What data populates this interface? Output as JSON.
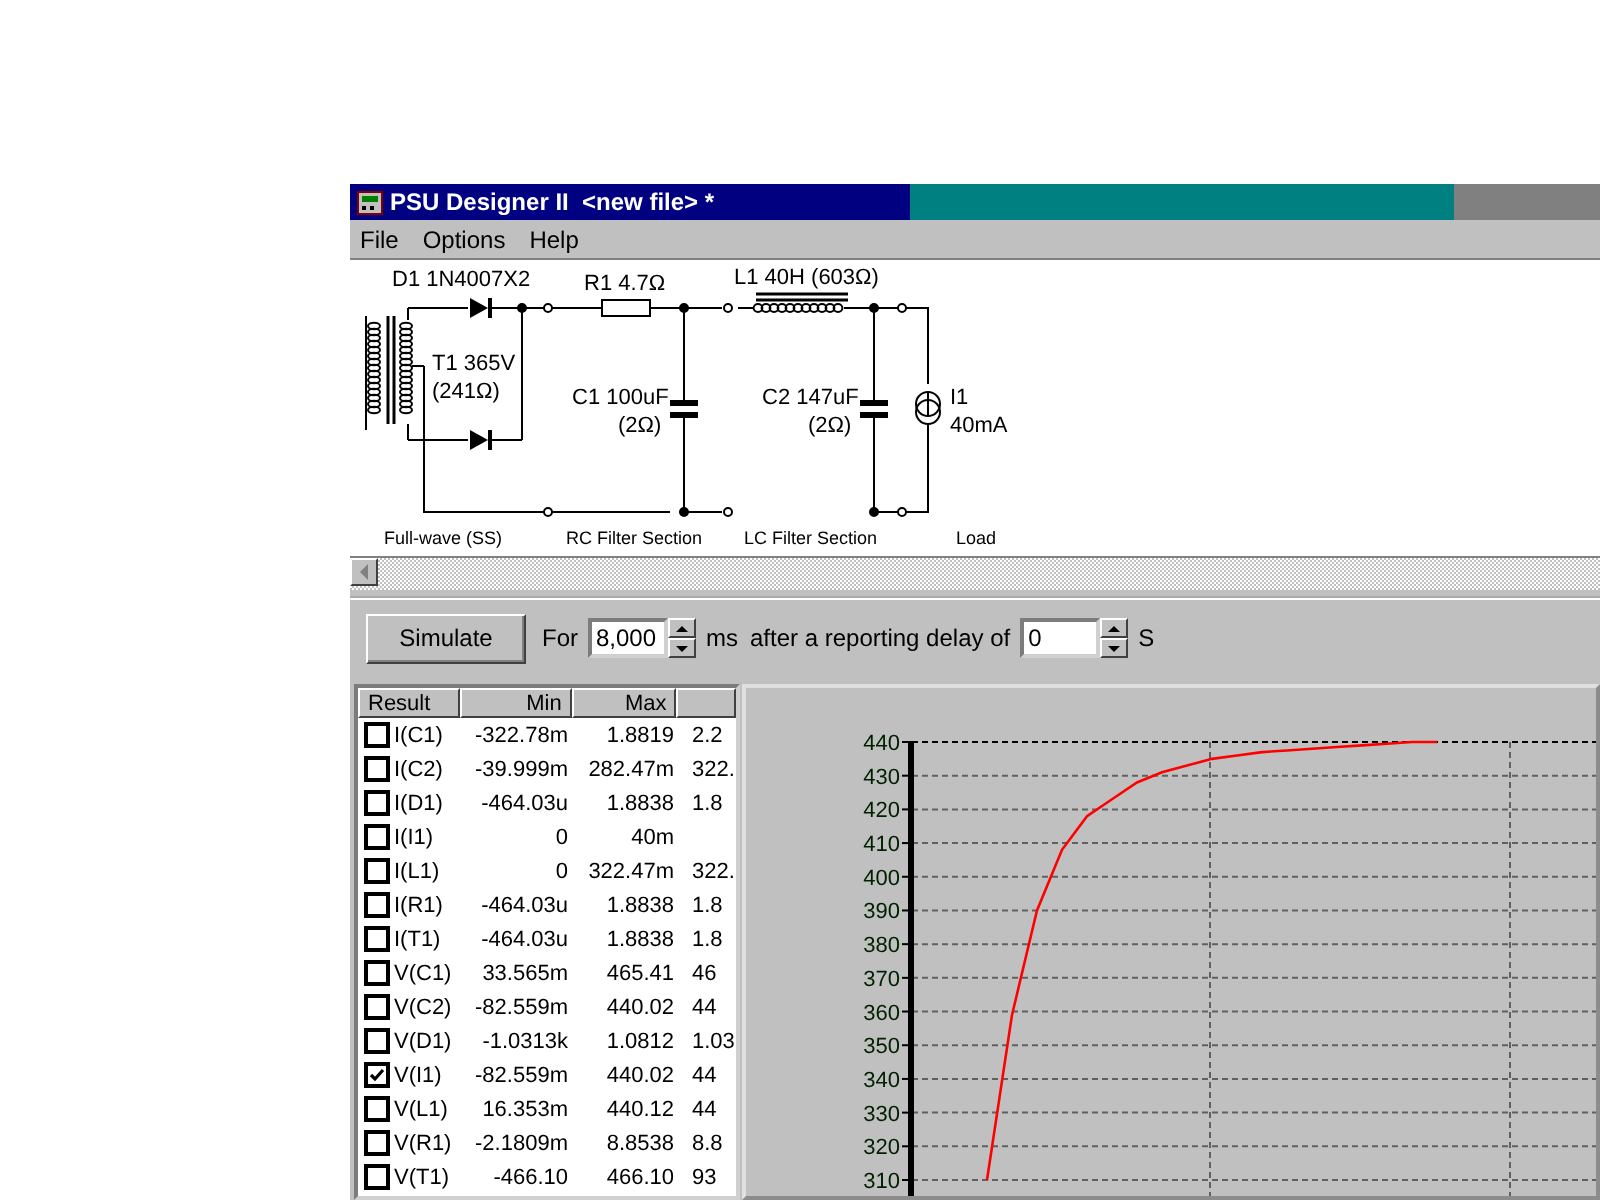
{
  "window": {
    "title": "PSU Designer II  <new file> *"
  },
  "menu": [
    "File",
    "Options",
    "Help"
  ],
  "schematic": {
    "components": [
      {
        "kind": "diode",
        "lines": [
          "D1 1N4007X2"
        ]
      },
      {
        "kind": "transformer",
        "lines": [
          "T1 365V",
          "(241Ω)"
        ]
      },
      {
        "kind": "resistor",
        "lines": [
          "R1 4.7Ω"
        ]
      },
      {
        "kind": "capacitor1",
        "lines": [
          "C1 100uF",
          "(2Ω)"
        ]
      },
      {
        "kind": "inductor",
        "lines": [
          "L1 40H (603Ω)"
        ]
      },
      {
        "kind": "capacitor2",
        "lines": [
          "C2 147uF",
          "(2Ω)"
        ]
      },
      {
        "kind": "load",
        "lines": [
          "I1",
          "40mA"
        ]
      }
    ],
    "sections": [
      "Full-wave (SS)",
      "RC Filter Section",
      "LC Filter Section",
      "Load"
    ]
  },
  "controls": {
    "simulate": "Simulate",
    "for_label": "For",
    "duration": "8,000",
    "duration_unit": "ms",
    "delay_label": "after a reporting delay of",
    "delay": "0",
    "delay_unit": "S"
  },
  "results": {
    "columns": [
      "Result",
      "Min",
      "Max"
    ],
    "rows": [
      {
        "name": "I(C1)",
        "min": "-322.78m",
        "max": "1.8819",
        "column_4": "2.2",
        "checked": false
      },
      {
        "name": "I(C2)",
        "min": "-39.999m",
        "max": "282.47m",
        "column_4": "322.",
        "checked": false
      },
      {
        "name": "I(D1)",
        "min": "-464.03u",
        "max": "1.8838",
        "column_4": "1.8",
        "checked": false
      },
      {
        "name": "I(I1)",
        "min": "0",
        "max": "40m",
        "checked": false
      },
      {
        "name": "I(L1)",
        "min": "0",
        "max": "322.47m",
        "column_4": "322.",
        "checked": false
      },
      {
        "name": "I(R1)",
        "min": "-464.03u",
        "max": "1.8838",
        "column_4": "1.8",
        "checked": false
      },
      {
        "name": "I(T1)",
        "min": "-464.03u",
        "max": "1.8838",
        "column_4": "1.8",
        "checked": false
      },
      {
        "name": "V(C1)",
        "min": "33.565m",
        "max": "465.41",
        "column_4": "46",
        "checked": false
      },
      {
        "name": "V(C2)",
        "min": "-82.559m",
        "max": "440.02",
        "column_4": "44",
        "checked": false
      },
      {
        "name": "V(D1)",
        "min": "-1.0313k",
        "max": "1.0812",
        "column_4": "1.03",
        "checked": false
      },
      {
        "name": "V(I1)",
        "min": "-82.559m",
        "max": "440.02",
        "column_4": "44",
        "checked": true
      },
      {
        "name": "V(L1)",
        "min": "16.353m",
        "max": "440.12",
        "column_4": "44",
        "checked": false
      },
      {
        "name": "V(R1)",
        "min": "-2.1809m",
        "max": "8.8538",
        "column_4": "8.8",
        "checked": false
      },
      {
        "name": "V(T1)",
        "min": "-466.10",
        "max": "466.10",
        "column_4": "93",
        "checked": false
      }
    ]
  },
  "chart": {
    "chart_data": {
      "type": "line",
      "grid": true,
      "ylim": [
        310,
        440
      ],
      "yticks": [
        310,
        320,
        330,
        340,
        350,
        360,
        370,
        380,
        390,
        400,
        410,
        420,
        430,
        440
      ],
      "categories": [
        null,
        null,
        null,
        null,
        null,
        null,
        null,
        null,
        null,
        null,
        null,
        null,
        null,
        null,
        null,
        null,
        null,
        null,
        null,
        null,
        null,
        null
      ],
      "series": [
        {
          "color": "#ff0000",
          "values": [
            null,
            null,
            null,
            310,
            359,
            390,
            408,
            418,
            423,
            428,
            431,
            433,
            435,
            436,
            437,
            437.5,
            438,
            438.5,
            439,
            439.5,
            440,
            440
          ]
        }
      ]
    }
  }
}
